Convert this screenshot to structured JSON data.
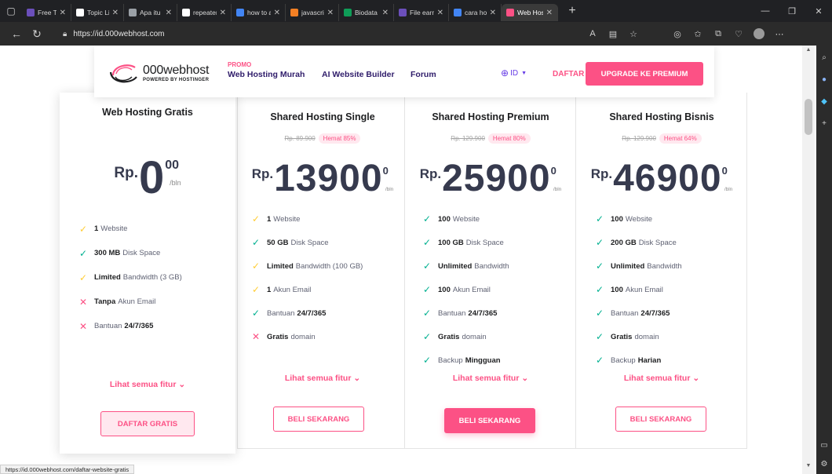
{
  "browser": {
    "tabs": [
      {
        "title": "Free Templ...",
        "favicon_color": "#6b4fbb"
      },
      {
        "title": "Topic Listin...",
        "favicon_color": "#ffffff"
      },
      {
        "title": "Apa itu Rep...",
        "favicon_color": "#9aa0a6"
      },
      {
        "title": "repeater ad...",
        "favicon_color": "#ffffff"
      },
      {
        "title": "how to add...",
        "favicon_color": "#4285f4"
      },
      {
        "title": "javascript -...",
        "favicon_color": "#f48024"
      },
      {
        "title": "Biodata Ma...",
        "favicon_color": "#0f9d58"
      },
      {
        "title": "File earmar...",
        "favicon_color": "#6b4fbb"
      },
      {
        "title": "cara hostin...",
        "favicon_color": "#4285f4"
      },
      {
        "title": "Web Hostin...",
        "favicon_color": "#fc5185"
      }
    ],
    "url": "https://id.000webhost.com",
    "status_url": "https://id.000webhost.com/daftar-website-gratis"
  },
  "header": {
    "logo_name": "000webhost",
    "logo_sub": "POWERED BY HOSTINGER",
    "promo": "PROMO",
    "menu": [
      "Web Hosting Murah",
      "AI Website Builder",
      "Forum"
    ],
    "lang": "ID",
    "signup": "DAFTAR",
    "upgrade": "UPGRADE KE PREMIUM"
  },
  "plans": [
    {
      "title": "Web Hosting Gratis",
      "currency": "Rp.",
      "amount": "0",
      "cents": "00",
      "per": "/bln",
      "features": [
        {
          "icon": "warn",
          "bold": "1",
          "text": "Website",
          "bold_after": ""
        },
        {
          "icon": "ok",
          "bold": "300 MB",
          "text": "Disk Space",
          "bold_after": ""
        },
        {
          "icon": "warn",
          "bold": "Limited",
          "text": "Bandwidth (3 GB)",
          "bold_after": ""
        },
        {
          "icon": "no",
          "bold": "Tanpa",
          "text": "Akun Email",
          "bold_after": ""
        },
        {
          "icon": "no",
          "bold": "",
          "text": "Bantuan",
          "bold_after": "24/7/365"
        }
      ],
      "see_all": "Lihat semua fitur",
      "cta": "DAFTAR GRATIS"
    },
    {
      "title": "Shared Hosting Single",
      "old_price": "Rp. 89.900",
      "save": "Hemat 85%",
      "currency": "Rp.",
      "amount": "13900",
      "cents": "0",
      "per": "/bln",
      "features": [
        {
          "icon": "warn",
          "bold": "1",
          "text": "Website",
          "bold_after": ""
        },
        {
          "icon": "ok",
          "bold": "50 GB",
          "text": "Disk Space",
          "bold_after": ""
        },
        {
          "icon": "warn",
          "bold": "Limited",
          "text": "Bandwidth (100 GB)",
          "bold_after": ""
        },
        {
          "icon": "warn",
          "bold": "1",
          "text": "Akun Email",
          "bold_after": ""
        },
        {
          "icon": "ok",
          "bold": "",
          "text": "Bantuan",
          "bold_after": "24/7/365"
        },
        {
          "icon": "no",
          "bold": "Gratis",
          "text": "domain",
          "bold_after": ""
        }
      ],
      "see_all": "Lihat semua fitur",
      "cta": "BELI SEKARANG"
    },
    {
      "title": "Shared Hosting Premium",
      "old_price": "Rp. 129.900",
      "save": "Hemat 80%",
      "currency": "Rp.",
      "amount": "25900",
      "cents": "0",
      "per": "/bln",
      "features": [
        {
          "icon": "ok",
          "bold": "100",
          "text": "Website",
          "bold_after": ""
        },
        {
          "icon": "ok",
          "bold": "100 GB",
          "text": "Disk Space",
          "bold_after": ""
        },
        {
          "icon": "ok",
          "bold": "Unlimited",
          "text": "Bandwidth",
          "bold_after": ""
        },
        {
          "icon": "ok",
          "bold": "100",
          "text": "Akun Email",
          "bold_after": ""
        },
        {
          "icon": "ok",
          "bold": "",
          "text": "Bantuan",
          "bold_after": "24/7/365"
        },
        {
          "icon": "ok",
          "bold": "Gratis",
          "text": "domain",
          "bold_after": ""
        },
        {
          "icon": "ok",
          "bold": "",
          "text": "Backup",
          "bold_after": "Mingguan"
        }
      ],
      "see_all": "Lihat semua fitur",
      "cta": "BELI SEKARANG"
    },
    {
      "title": "Shared Hosting Bisnis",
      "old_price": "Rp. 129.900",
      "save": "Hemat 64%",
      "currency": "Rp.",
      "amount": "46900",
      "cents": "0",
      "per": "/bln",
      "features": [
        {
          "icon": "ok",
          "bold": "100",
          "text": "Website",
          "bold_after": ""
        },
        {
          "icon": "ok",
          "bold": "200 GB",
          "text": "Disk Space",
          "bold_after": ""
        },
        {
          "icon": "ok",
          "bold": "Unlimited",
          "text": "Bandwidth",
          "bold_after": ""
        },
        {
          "icon": "ok",
          "bold": "100",
          "text": "Akun Email",
          "bold_after": ""
        },
        {
          "icon": "ok",
          "bold": "",
          "text": "Bantuan",
          "bold_after": "24/7/365"
        },
        {
          "icon": "ok",
          "bold": "Gratis",
          "text": "domain",
          "bold_after": ""
        },
        {
          "icon": "ok",
          "bold": "",
          "text": "Backup",
          "bold_after": "Harian"
        }
      ],
      "see_all": "Lihat semua fitur",
      "cta": "BELI SEKARANG"
    }
  ],
  "colors": {
    "accent": "#fc5185",
    "check_ok": "#00b090",
    "check_warn": "#ffcd35",
    "brand": "#673de6"
  }
}
